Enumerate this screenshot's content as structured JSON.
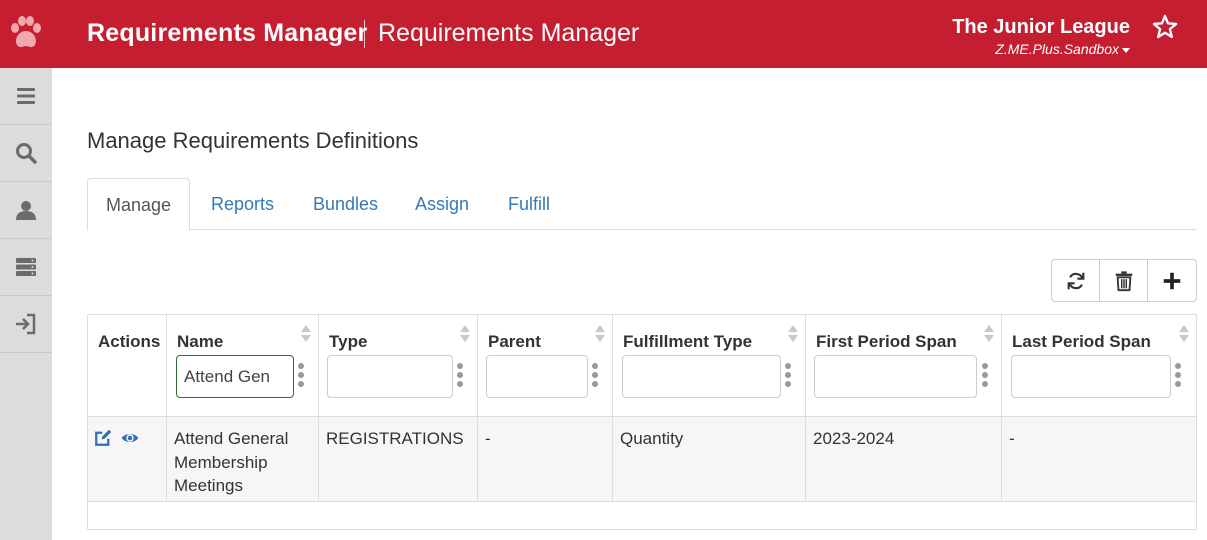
{
  "header": {
    "app_title": "Requirements Manager",
    "app_subtitle": "Requirements Manager",
    "org_name": "The Junior League",
    "org_environment": "Z.ME.Plus.Sandbox",
    "brand_color": "#c41e30"
  },
  "sidebar": {
    "items": [
      {
        "icon": "menu-icon"
      },
      {
        "icon": "search-icon"
      },
      {
        "icon": "user-icon"
      },
      {
        "icon": "server-icon"
      },
      {
        "icon": "logout-icon"
      }
    ]
  },
  "page": {
    "heading": "Manage Requirements Definitions"
  },
  "tabs": [
    {
      "label": "Manage",
      "active": true
    },
    {
      "label": "Reports",
      "active": false
    },
    {
      "label": "Bundles",
      "active": false
    },
    {
      "label": "Assign",
      "active": false
    },
    {
      "label": "Fulfill",
      "active": false
    }
  ],
  "toolbar": {
    "buttons": [
      {
        "icon": "refresh-icon"
      },
      {
        "icon": "trash-icon"
      },
      {
        "icon": "plus-icon"
      }
    ]
  },
  "table": {
    "columns": [
      {
        "label": "Actions"
      },
      {
        "label": "Name",
        "filter_value": "Attend Gen"
      },
      {
        "label": "Type",
        "filter_value": ""
      },
      {
        "label": "Parent",
        "filter_value": ""
      },
      {
        "label": "Fulfillment Type",
        "filter_value": ""
      },
      {
        "label": "First Period Span",
        "filter_value": ""
      },
      {
        "label": "Last Period Span",
        "filter_value": ""
      }
    ],
    "rows": [
      {
        "name": "Attend General Membership Meetings",
        "type": "REGISTRATIONS",
        "parent": "-",
        "fulfillment_type": "Quantity",
        "first_period_span": "2023-2024",
        "last_period_span": "-"
      }
    ]
  }
}
